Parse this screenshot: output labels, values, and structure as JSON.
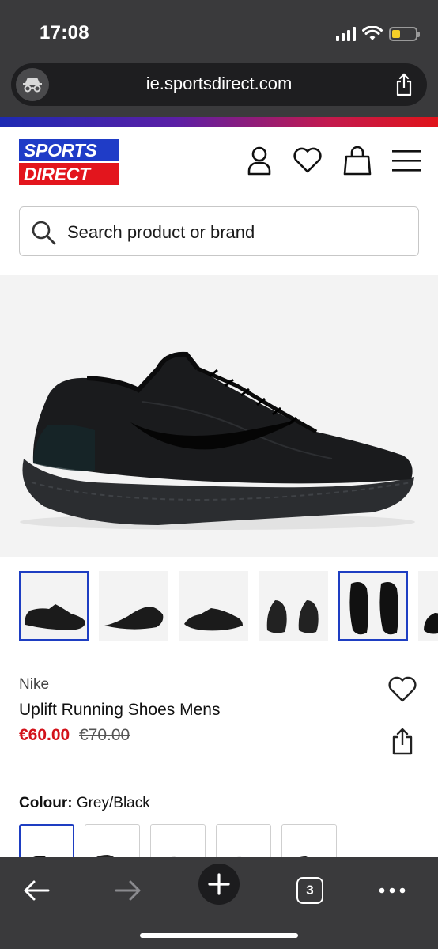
{
  "status_bar": {
    "time": "17:08"
  },
  "browser": {
    "url": "ie.sportsdirect.com",
    "tab_count": "3"
  },
  "site": {
    "logo_line1": "SPORTS",
    "logo_line2": "DIRECT",
    "search_placeholder": "Search product or brand"
  },
  "product": {
    "brand": "Nike",
    "title": "Uplift Running Shoes Mens",
    "price": "€60.00",
    "was_price": "€70.00",
    "colour_label": "Colour:",
    "colour_value": "Grey/Black"
  },
  "colors": {
    "brand_blue": "#1f3cc7",
    "brand_red": "#e3151d",
    "sale_red": "#d3121a",
    "selection_blue": "#1e3ec2"
  },
  "icons": [
    "incognito-icon",
    "share-icon",
    "account-icon",
    "heart-icon",
    "bag-icon",
    "menu-icon",
    "search-icon",
    "back-icon",
    "forward-icon",
    "plus-icon",
    "more-icon"
  ]
}
